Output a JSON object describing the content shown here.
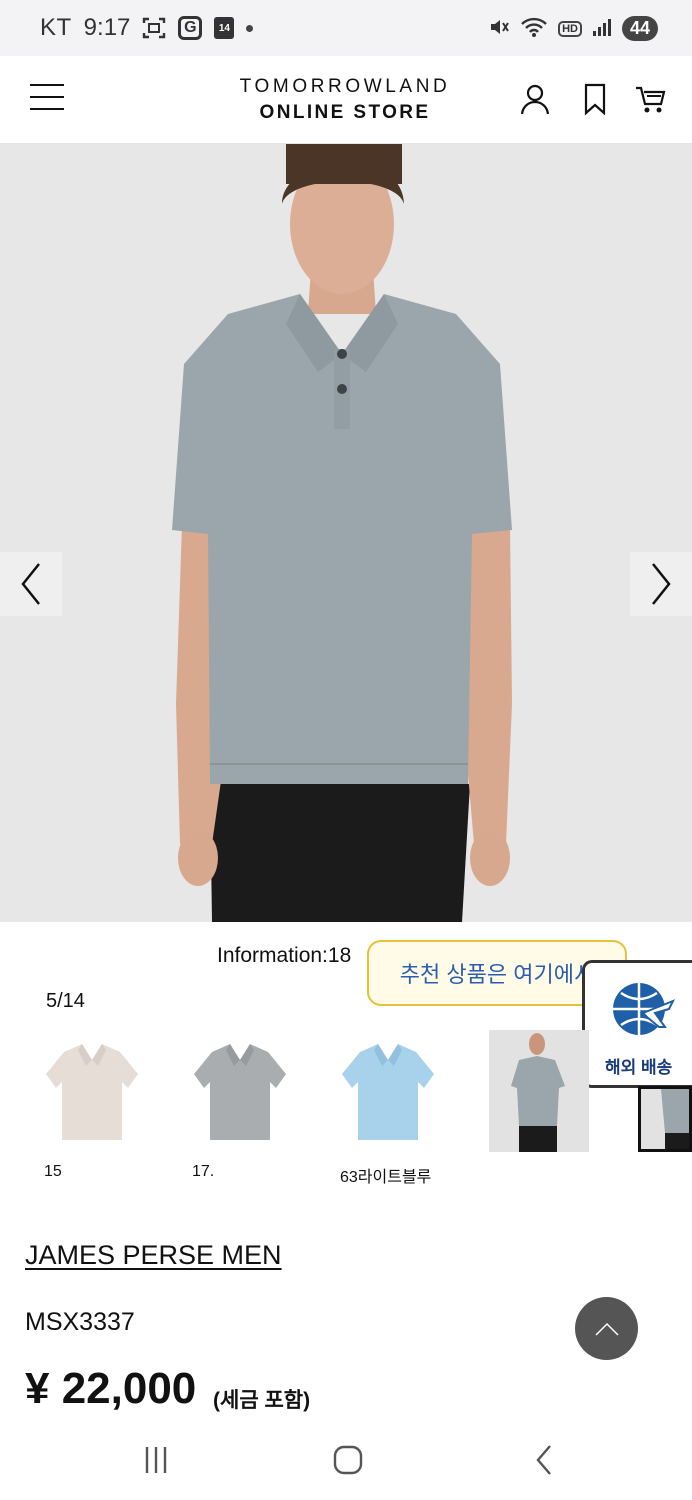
{
  "status_bar": {
    "carrier": "KT",
    "time": "9:17",
    "calendar_day": "14",
    "battery": "44",
    "hd_badge": "HD"
  },
  "header": {
    "logo_line1": "TOMORROWLAND",
    "logo_line2": "ONLINE STORE",
    "icons": [
      "menu-icon",
      "account-icon",
      "bookmark-icon",
      "cart-icon"
    ]
  },
  "gallery": {
    "info_text": "Information:18",
    "counter": "5/14",
    "thumbnails": [
      {
        "label": "15",
        "color": "#e4dcd6"
      },
      {
        "label": "17.",
        "color": "#a9adaf"
      },
      {
        "label": "63라이트블루",
        "color": "#a8d1ec"
      }
    ]
  },
  "tooltip": {
    "text": "추천 상품은 여기에서"
  },
  "overseas": {
    "label": "해외 배송"
  },
  "product": {
    "brand": "JAMES PERSE MEN",
    "sku": "MSX3337",
    "price": "¥ 22,000",
    "price_note": "(세금 포함)"
  },
  "colors": {
    "shirt": "#9aa6ab",
    "pants": "#1b1b1b",
    "tooltip_border": "#e4c23a",
    "tooltip_text": "#2a5db0"
  }
}
